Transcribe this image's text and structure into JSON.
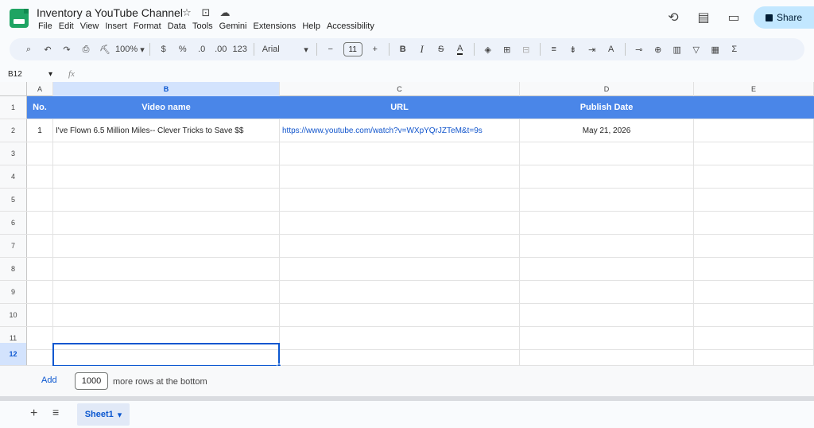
{
  "title": {
    "doc_name": "Inventory a YouTube Channel",
    "star_icon": "☆",
    "move_icon": "⊡",
    "cloud_icon": "☁"
  },
  "menu": [
    "File",
    "Edit",
    "View",
    "Insert",
    "Format",
    "Data",
    "Tools",
    "Gemini",
    "Extensions",
    "Help",
    "Accessibility"
  ],
  "header_right": {
    "history_icon": "⟲",
    "comment_icon": "▤",
    "meet_icon": "▭",
    "share_label": "Share"
  },
  "toolbar": {
    "search": "⌕",
    "undo": "↶",
    "redo": "↷",
    "print": "⎙",
    "paint_format": "⛏",
    "zoom": "100%",
    "currency": "$",
    "percent": "%",
    "dec_decrease": ".0",
    "dec_increase": ".00",
    "number_format": "123",
    "font": "Arial",
    "font_size": "11",
    "minus": "−",
    "plus": "+",
    "bold": "B",
    "italic": "I",
    "strike": "S",
    "text_color": "A",
    "fill": "◈",
    "borders": "⊞",
    "merge": "⊟",
    "halign": "≡",
    "valign": "⇟",
    "wrap": "⇥",
    "rotate": "A",
    "link": "⊸",
    "comment": "⊕",
    "chart": "▥",
    "filter": "▽",
    "views": "▦",
    "functions": "Σ"
  },
  "formula_bar": {
    "cell_ref": "B12",
    "fx": "fx",
    "content": ""
  },
  "columns": [
    "A",
    "B",
    "C",
    "D",
    "E"
  ],
  "selected_column": "B",
  "sheet_header": {
    "no": "No.",
    "video_name": "Video name",
    "url": "URL",
    "publish_date": "Publish Date"
  },
  "rows": [
    {
      "no": "1",
      "video_name": "I've Flown 6.5 Million Miles-- Clever Tricks to Save $$",
      "url": "https://www.youtube.com/watch?v=WXpYQrJZTeM&t=9s",
      "publish_date": "May 21, 2026"
    }
  ],
  "row_numbers": [
    "1",
    "2",
    "3",
    "4",
    "5",
    "6",
    "7",
    "8",
    "9",
    "10",
    "11",
    "12"
  ],
  "selected_row": "12",
  "footer": {
    "add_label": "Add",
    "rows_count": "1000",
    "rows_suffix": "more rows at the bottom"
  },
  "tabs": {
    "add_icon": "+",
    "list_icon": "≡",
    "sheet_name": "Sheet1"
  },
  "colors": {
    "header_fill": "#4a86e8",
    "accent": "#0b57d0",
    "link": "#1155cc"
  }
}
